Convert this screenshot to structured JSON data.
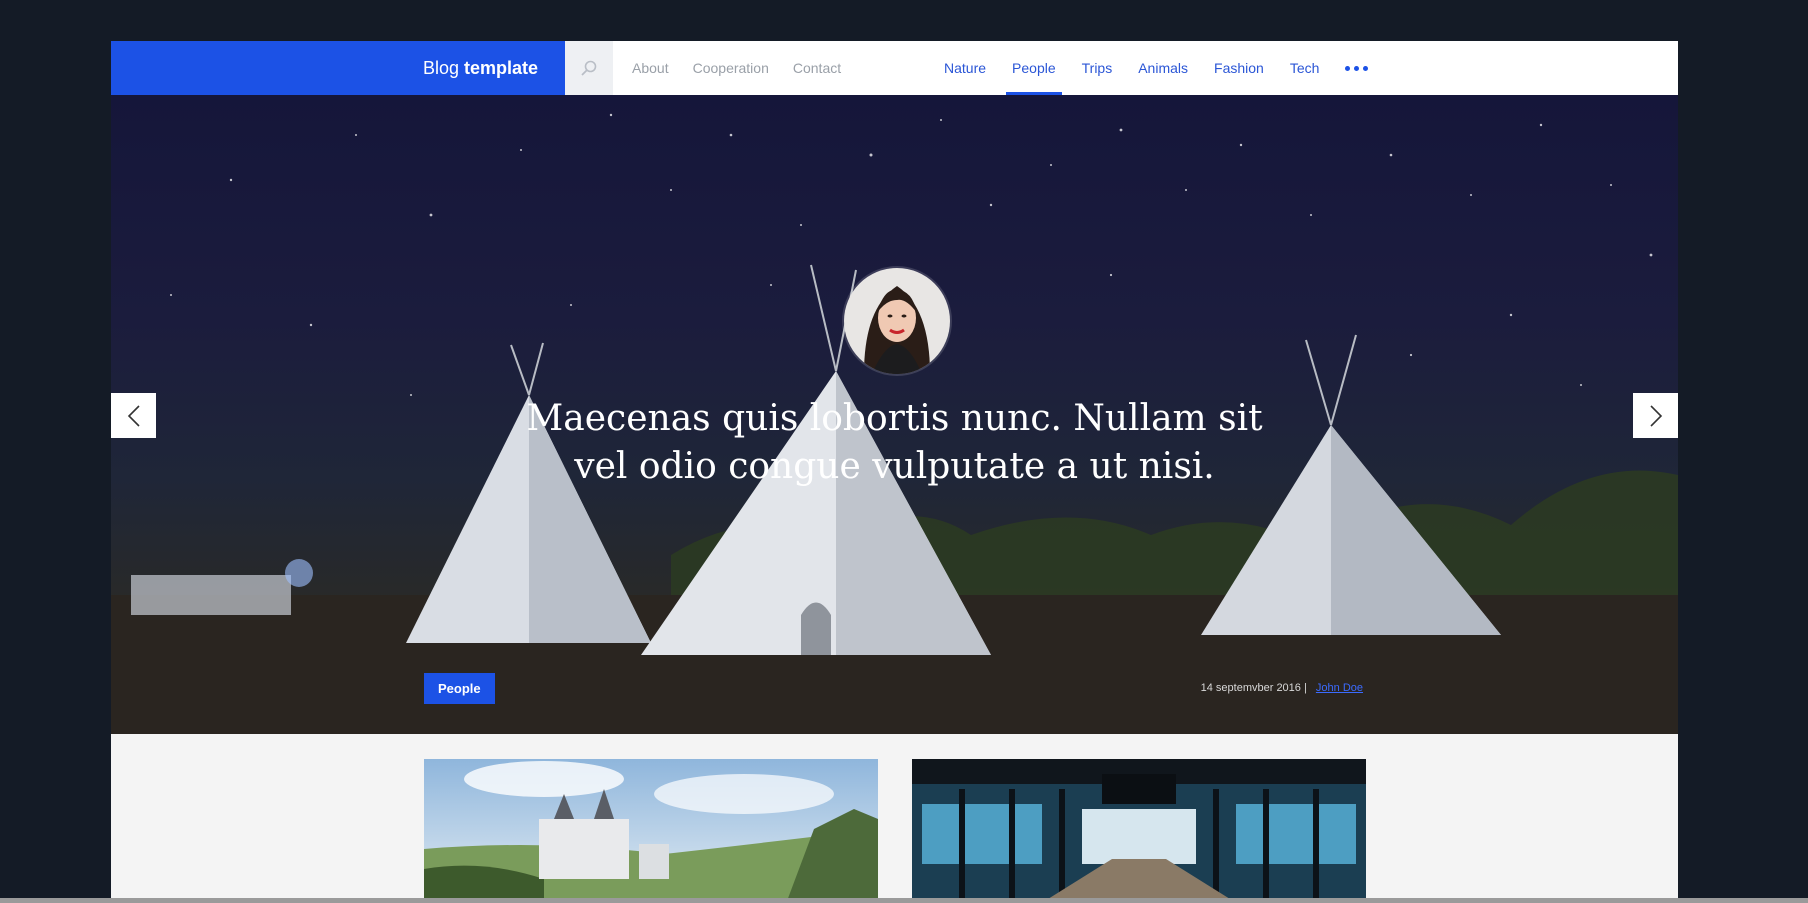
{
  "brand": {
    "part1": "Blog",
    "part2": "template"
  },
  "nav_left": [
    "About",
    "Cooperation",
    "Contact"
  ],
  "nav_right": [
    "Nature",
    "People",
    "Trips",
    "Animals",
    "Fashion",
    "Tech"
  ],
  "active_nav": "People",
  "hero": {
    "headline": "Maecenas quis lobortis nunc. Nullam sit vel odio congue vulputate a ut nisi.",
    "category": "People",
    "date": "14 septemvber 2016",
    "separator": "|",
    "author": "John Doe"
  },
  "colors": {
    "accent": "#1c52e6",
    "page_bg": "#141b26"
  },
  "icons": {
    "search": "search-icon",
    "more": "more-dots-icon",
    "prev": "chevron-left-icon",
    "next": "chevron-right-icon"
  }
}
